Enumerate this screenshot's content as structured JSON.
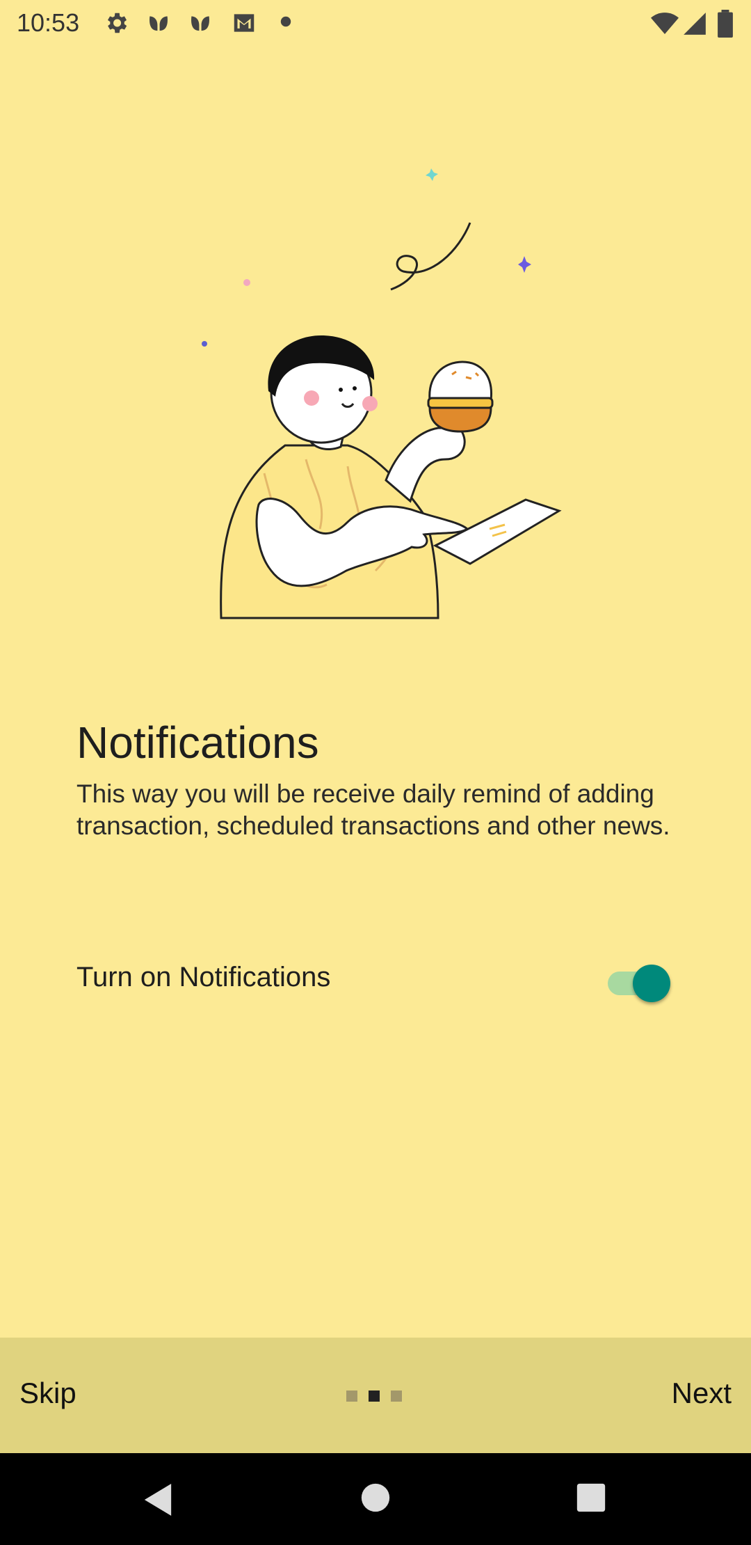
{
  "status_bar": {
    "time": "10:53",
    "left_icons": [
      "gear-icon",
      "leaf-icon",
      "leaf-icon",
      "gmail-icon",
      "dot-icon"
    ],
    "right_icons": [
      "wifi-icon",
      "signal-icon",
      "battery-icon"
    ]
  },
  "onboarding": {
    "title": "Notifications",
    "description": "This way you will be receive daily remind of adding transaction, scheduled transactions and other news.",
    "toggle": {
      "label": "Turn on Notifications",
      "checked": true
    }
  },
  "bottom_bar": {
    "skip_label": "Skip",
    "next_label": "Next",
    "pages": 3,
    "active_page": 2
  },
  "nav_bar": {
    "buttons": [
      "back-icon",
      "home-icon",
      "recents-icon"
    ]
  },
  "colors": {
    "background": "#fcea95",
    "bottom_bar": "#e0d37f",
    "switch_thumb": "#00897b",
    "switch_track": "#a8d9a0"
  }
}
